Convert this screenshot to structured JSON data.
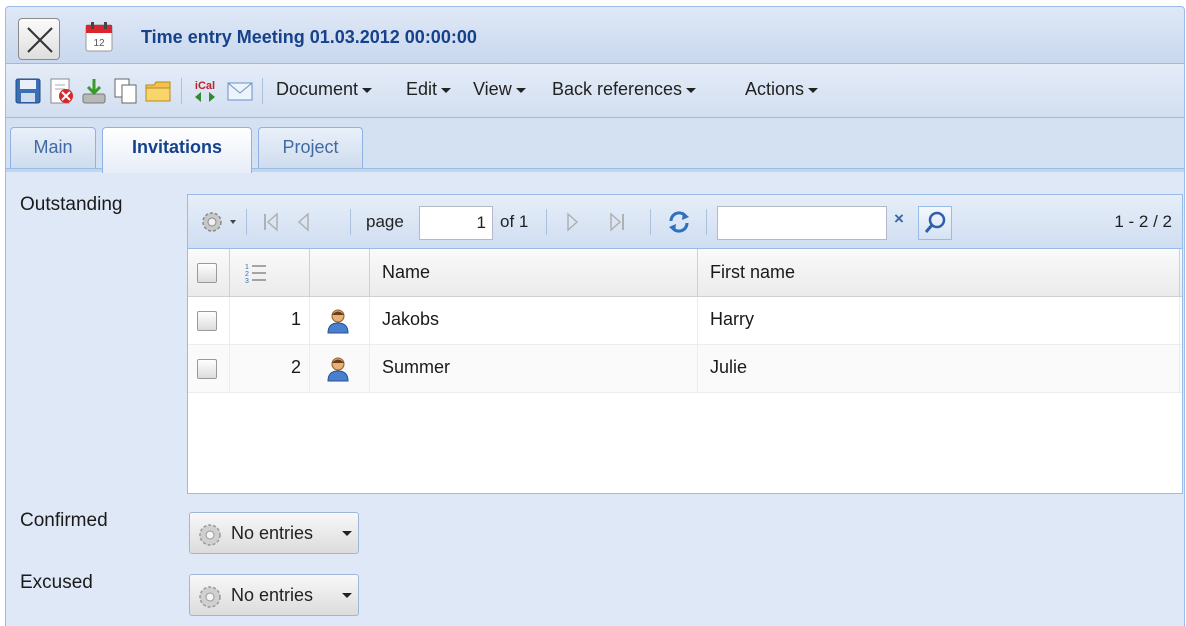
{
  "window": {
    "title": "Time entry Meeting 01.03.2012 00:00:00"
  },
  "toolbar": {
    "buttons": [
      "save-icon",
      "delete-icon",
      "download-icon",
      "copy-icon",
      "folder-icon",
      "ical-icon",
      "mail-icon"
    ],
    "ical_label": "iCal",
    "menus": [
      "Document",
      "Edit",
      "View",
      "Back references",
      "Actions"
    ]
  },
  "tabs": [
    {
      "label": "Main",
      "active": false
    },
    {
      "label": "Invitations",
      "active": true
    },
    {
      "label": "Project",
      "active": false
    }
  ],
  "sections": {
    "outstanding": "Outstanding",
    "confirmed": "Confirmed",
    "excused": "Excused"
  },
  "pager": {
    "page_label": "page",
    "page_value": "1",
    "of_label": "of 1",
    "search_value": "",
    "clear_symbol": "×",
    "count": "1 - 2 / 2"
  },
  "grid": {
    "columns": [
      "Name",
      "First name"
    ],
    "rows": [
      {
        "num": "1",
        "name": "Jakobs",
        "first_name": "Harry"
      },
      {
        "num": "2",
        "name": "Summer",
        "first_name": "Julie"
      }
    ]
  },
  "confirmed_button": {
    "label": "No entries"
  },
  "excused_button": {
    "label": "No entries"
  },
  "colors": {
    "accent": "#15428b",
    "panel": "#dfe8f6",
    "border": "#99bbe8"
  }
}
